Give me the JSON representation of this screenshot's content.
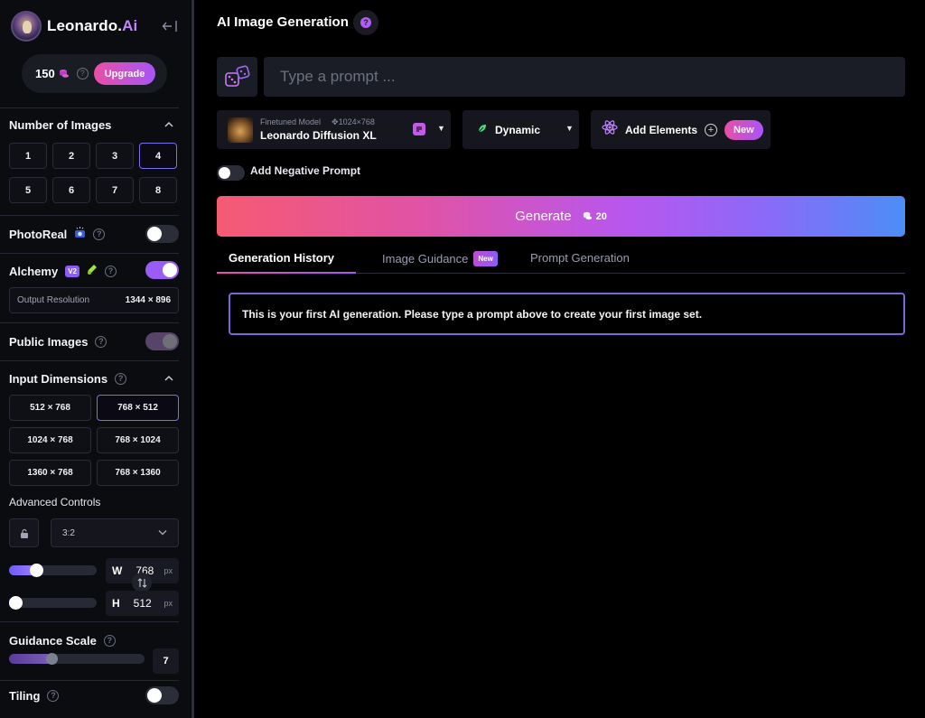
{
  "brand": {
    "name": "Leonardo.",
    "name_suffix": "Ai"
  },
  "credits": {
    "amount": "150",
    "upgrade_label": "Upgrade"
  },
  "sidebar": {
    "num_images": {
      "title": "Number of Images",
      "options": [
        "1",
        "2",
        "3",
        "4",
        "5",
        "6",
        "7",
        "8"
      ],
      "selected": "4"
    },
    "photoreal": {
      "label": "PhotoReal",
      "enabled": false
    },
    "alchemy": {
      "label": "Alchemy",
      "badge": "V2",
      "enabled": true
    },
    "output_resolution": {
      "label": "Output Resolution",
      "value": "1344 × 896"
    },
    "public_images": {
      "label": "Public Images",
      "enabled": true
    },
    "input_dimensions": {
      "title": "Input Dimensions",
      "options": [
        "512 × 768",
        "768 × 512",
        "1024 × 768",
        "768 × 1024",
        "1360 × 768",
        "768 × 1360"
      ],
      "selected": "768 × 512"
    },
    "advanced": {
      "title": "Advanced Controls",
      "aspect_ratio": "3:2",
      "width": {
        "label": "W",
        "value": "768",
        "unit": "px",
        "slider_fraction": 0.24
      },
      "height": {
        "label": "H",
        "value": "512",
        "unit": "px",
        "slider_fraction": 0.0
      }
    },
    "guidance": {
      "label": "Guidance Scale",
      "value": "7",
      "slider_fraction": 0.32
    },
    "tiling": {
      "label": "Tiling",
      "enabled": false
    }
  },
  "main": {
    "title": "AI Image Generation",
    "prompt_placeholder": "Type a prompt ...",
    "model": {
      "caption": "Finetuned Model",
      "resolution": "1024×768",
      "name": "Leonardo Diffusion XL"
    },
    "style": {
      "label": "Dynamic"
    },
    "elements": {
      "label": "Add Elements",
      "badge": "New"
    },
    "negative_prompt": {
      "label": "Add Negative Prompt",
      "enabled": false
    },
    "generate": {
      "label": "Generate",
      "cost": "20"
    },
    "tabs": [
      {
        "label": "Generation History",
        "active": true
      },
      {
        "label": "Image Guidance",
        "badge": "New"
      },
      {
        "label": "Prompt Generation"
      }
    ],
    "info_message": "This is your first AI generation. Please type a prompt above to create your first image set."
  },
  "colors": {
    "accent": "#a855f7",
    "pink": "#e84fa6",
    "background": "#000000",
    "sidebar": "#0b0c10"
  }
}
